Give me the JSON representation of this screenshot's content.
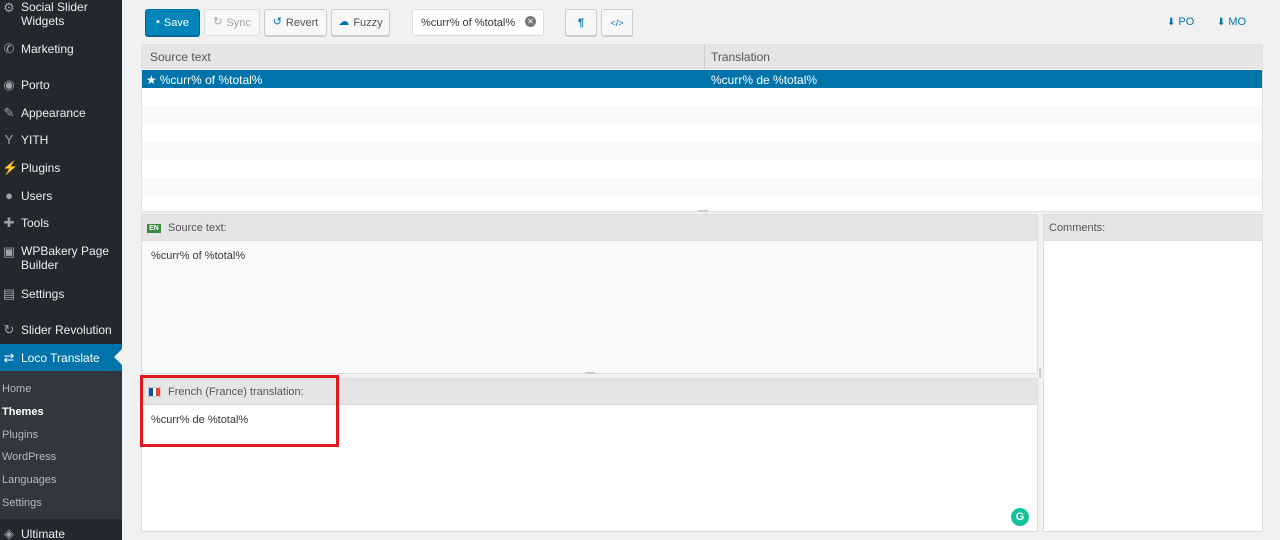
{
  "sidebar": {
    "items": [
      {
        "label": "Social Slider Widgets",
        "icon": "gear-icon"
      },
      {
        "label": "Marketing",
        "icon": "megaphone-icon"
      },
      {
        "label": "Porto",
        "icon": "circle-icon"
      },
      {
        "label": "Appearance",
        "icon": "brush-icon"
      },
      {
        "label": "YITH",
        "icon": "yith-icon"
      },
      {
        "label": "Plugins",
        "icon": "plug-icon"
      },
      {
        "label": "Users",
        "icon": "user-icon"
      },
      {
        "label": "Tools",
        "icon": "wrench-icon"
      },
      {
        "label": "WPBakery Page Builder",
        "icon": "builder-icon"
      },
      {
        "label": "Settings",
        "icon": "sliders-icon"
      },
      {
        "label": "Slider Revolution",
        "icon": "refresh-icon"
      },
      {
        "label": "Loco Translate",
        "icon": "translate-icon"
      },
      {
        "label": "Ultimate",
        "icon": "shield-icon"
      }
    ],
    "submenu": [
      "Home",
      "Themes",
      "Plugins",
      "WordPress",
      "Languages",
      "Settings"
    ]
  },
  "toolbar": {
    "save_label": "Save",
    "sync_label": "Sync",
    "revert_label": "Revert",
    "fuzzy_label": "Fuzzy",
    "search_value": "%curr% of %total%",
    "pilcrow_label": "¶",
    "code_label": "</>",
    "po_label": "PO",
    "mo_label": "MO"
  },
  "grid": {
    "col_source": "Source text",
    "col_translation": "Translation",
    "rows": [
      {
        "source": "%curr% of %total%",
        "translation": "%curr% de %total%"
      }
    ]
  },
  "editor": {
    "source_badge": "EN",
    "source_heading": "Source text:",
    "source_text": "%curr% of %total%",
    "translation_heading": "French (France) translation:",
    "translation_text": "%curr% de %total%",
    "comments_heading": "Comments:",
    "grammarly_glyph": "G"
  },
  "colors": {
    "sidebar_bg": "#23282d",
    "accent": "#0073aa",
    "highlight": "#e0191f",
    "grammarly": "#15c39a"
  }
}
